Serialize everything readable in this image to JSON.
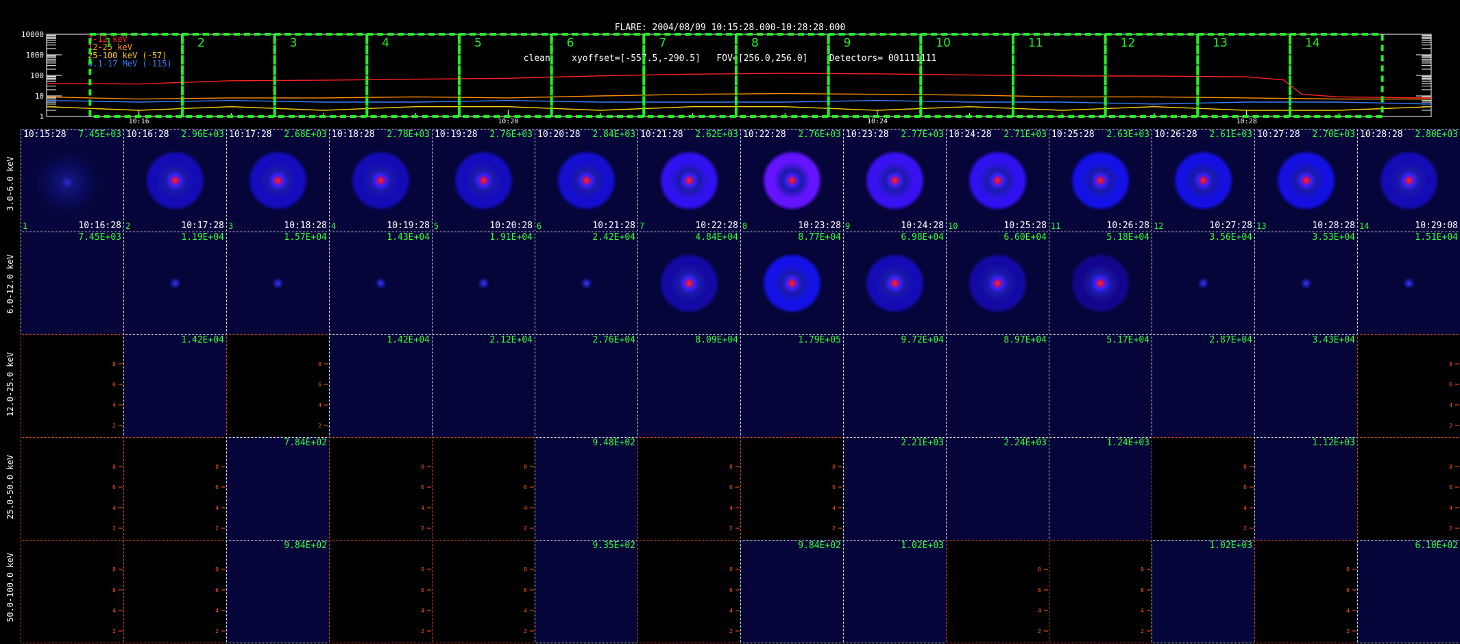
{
  "header": {
    "line1": "FLARE: 2004/08/09 10:15:28.000-10:28:28.000",
    "line2": "clean    xyoffset=[-557.5,-290.5]   FOV=[256.0,256.0]    Detectors= 001111111"
  },
  "chart_data": [
    {
      "type": "line",
      "y_scale": "log",
      "ylim": [
        1,
        10000
      ],
      "ytick_labels": [
        "10000",
        "1000",
        "100",
        "10",
        "1"
      ],
      "xtick_labels": [
        "10:16",
        "10:20",
        "10:24",
        "10:28"
      ],
      "xlim_minutes": [
        15.0,
        30.0
      ],
      "series": [
        {
          "name": "3-12 keV",
          "color": "#ff2020",
          "x": [
            15,
            16,
            17,
            18,
            19,
            20,
            21,
            22,
            23,
            24,
            25,
            26,
            27,
            28,
            28.4,
            28.6,
            29,
            30
          ],
          "y": [
            40,
            38,
            55,
            58,
            65,
            72,
            95,
            115,
            125,
            118,
            105,
            95,
            92,
            85,
            60,
            12,
            9,
            8
          ]
        },
        {
          "name": "12-25 keV",
          "color": "#ff8c00",
          "x": [
            15,
            16,
            17,
            18,
            19,
            20,
            21,
            22,
            23,
            24,
            25,
            26,
            27,
            28,
            29,
            30
          ],
          "y": [
            9,
            7,
            8,
            8,
            9,
            8,
            10,
            12,
            13,
            12,
            11,
            9,
            9,
            8,
            7,
            7
          ]
        },
        {
          "name": "25-100 keV (-57)",
          "color": "#ffd000",
          "x": [
            15,
            16,
            17,
            18,
            19,
            20,
            21,
            22,
            23,
            24,
            25,
            26,
            27,
            28,
            29,
            30
          ],
          "y": [
            3,
            2,
            3,
            2,
            3,
            3,
            2,
            3,
            3,
            2,
            3,
            2,
            3,
            2,
            2,
            3
          ]
        },
        {
          "name": "0.1-17 MeV (-115)",
          "color": "#3a7dff",
          "x": [
            15,
            16,
            17,
            18,
            19,
            20,
            21,
            22,
            23,
            24,
            25,
            26,
            27,
            28,
            29,
            30
          ],
          "y": [
            6,
            5,
            6,
            5,
            5,
            6,
            5,
            5,
            5,
            6,
            5,
            5,
            4,
            5,
            5,
            4
          ]
        }
      ],
      "annotations": {
        "intervals": [
          "1",
          "2",
          "3",
          "4",
          "5",
          "6",
          "7",
          "8",
          "9",
          "10",
          "11",
          "12",
          "13",
          "14"
        ],
        "interval_start_minute": 15.47,
        "interval_minutes": 1.0,
        "box_color": "#22ee22"
      }
    },
    {
      "type": "image_grid",
      "rows": [
        "3.0-6.0 keV",
        "6.0-12.0 keV",
        "12.0-25.0 keV",
        "25.0-50.0 keV",
        "50.0-100.0 keV"
      ],
      "start_times": [
        "10:15:28",
        "10:16:28",
        "10:17:28",
        "10:18:28",
        "10:19:28",
        "10:20:28",
        "10:21:28",
        "10:22:28",
        "10:23:28",
        "10:24:28",
        "10:25:28",
        "10:26:28",
        "10:27:28",
        "10:28:28"
      ],
      "end_times": [
        "10:16:28",
        "10:17:28",
        "10:18:28",
        "10:19:28",
        "10:20:28",
        "10:21:28",
        "10:22:28",
        "10:23:28",
        "10:24:28",
        "10:25:28",
        "10:26:28",
        "10:27:28",
        "10:28:28",
        "10:29:08"
      ],
      "frame_numbers": [
        "1",
        "2",
        "3",
        "4",
        "5",
        "6",
        "7",
        "8",
        "9",
        "10",
        "11",
        "12",
        "13",
        "14"
      ],
      "axis_tick_labels": [
        "2",
        "4",
        "6",
        "8"
      ],
      "max_values": [
        [
          "7.45E+03",
          "2.96E+03",
          "2.68E+03",
          "2.78E+03",
          "2.76E+03",
          "2.84E+03",
          "2.62E+03",
          "2.76E+03",
          "2.77E+03",
          "2.71E+03",
          "2.63E+03",
          "2.61E+03",
          "2.70E+03",
          "2.80E+03"
        ],
        [
          "7.45E+03",
          "1.19E+04",
          "1.57E+04",
          "1.43E+04",
          "1.91E+04",
          "2.42E+04",
          "4.84E+04",
          "8.77E+04",
          "6.98E+04",
          "6.60E+04",
          "5.18E+04",
          "3.56E+04",
          "3.53E+04",
          "1.51E+04"
        ],
        [
          "",
          "1.42E+04",
          "",
          "1.42E+04",
          "2.12E+04",
          "2.76E+04",
          "8.09E+04",
          "1.79E+05",
          "9.72E+04",
          "8.97E+04",
          "5.17E+04",
          "2.87E+04",
          "3.43E+04",
          ""
        ],
        [
          "",
          "",
          "7.84E+02",
          "",
          "",
          "9.48E+02",
          "",
          "",
          "2.21E+03",
          "2.24E+03",
          "1.24E+03",
          "",
          "1.12E+03",
          ""
        ],
        [
          "",
          "",
          "9.84E+02",
          "",
          "",
          "9.35E+02",
          "",
          "9.84E+02",
          "1.02E+03",
          "",
          "",
          "1.02E+03",
          "",
          "6.10E+02"
        ]
      ],
      "image_kind": [
        [
          "halo",
          "ring",
          "ring",
          "ring",
          "ring",
          "ring",
          "ring",
          "ring",
          "ring",
          "ring",
          "ring",
          "ring",
          "ring",
          "ring"
        ],
        [
          "plain",
          "dot",
          "dot",
          "dot",
          "dot",
          "dot",
          "ring",
          "ring",
          "ring",
          "ring",
          "ring",
          "dot",
          "dot",
          "dot"
        ],
        [
          "empty",
          "plain",
          "empty",
          "plain",
          "plain",
          "plain",
          "plain",
          "plain",
          "plain",
          "plain",
          "plain",
          "plain",
          "plain",
          "empty"
        ],
        [
          "empty",
          "empty",
          "plain",
          "empty",
          "empty",
          "plain",
          "empty",
          "empty",
          "plain",
          "plain",
          "plain",
          "empty",
          "plain",
          "empty"
        ],
        [
          "empty",
          "empty",
          "plain",
          "empty",
          "empty",
          "plain",
          "empty",
          "plain",
          "plain",
          "empty",
          "empty",
          "plain",
          "empty",
          "plain"
        ]
      ],
      "ring_intensity": [
        [
          0.25,
          0.55,
          0.6,
          0.55,
          0.6,
          0.7,
          0.9,
          1.0,
          0.92,
          0.9,
          0.85,
          0.82,
          0.82,
          0.55
        ],
        [
          0,
          0.1,
          0.1,
          0.1,
          0.15,
          0.2,
          0.45,
          0.85,
          0.55,
          0.45,
          0.3,
          0.15,
          0.15,
          0.12
        ],
        [
          0,
          0,
          0,
          0,
          0,
          0,
          0,
          0,
          0,
          0,
          0,
          0,
          0,
          0
        ],
        [
          0,
          0,
          0,
          0,
          0,
          0,
          0,
          0,
          0,
          0,
          0,
          0,
          0,
          0
        ],
        [
          0,
          0,
          0,
          0,
          0,
          0,
          0,
          0,
          0,
          0,
          0,
          0,
          0,
          0
        ]
      ],
      "colors": {
        "border": "#ffffff",
        "empty_border": "#ff5a1a",
        "plain_background": "#05053a",
        "empty_background": "#000000"
      }
    }
  ]
}
